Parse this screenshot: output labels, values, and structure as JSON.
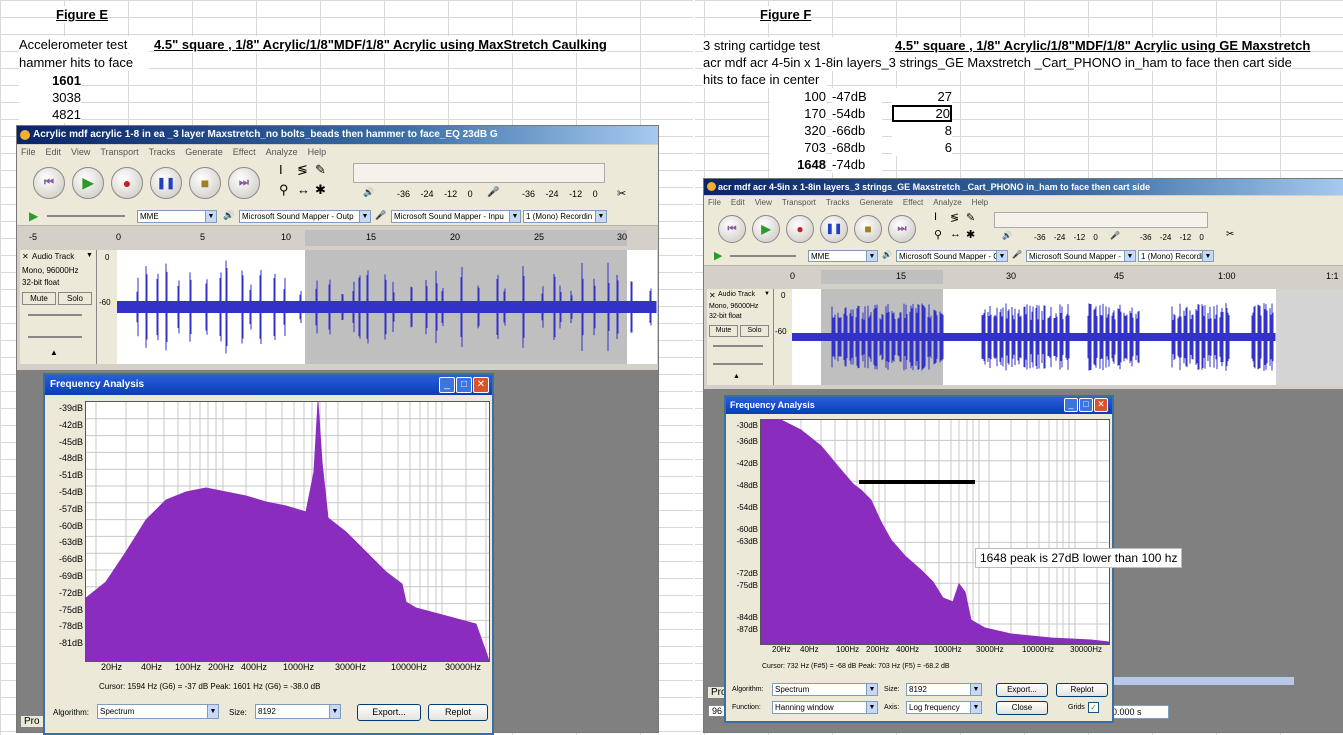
{
  "left": {
    "figure_title": "Figure E",
    "test_label": "Accelerometer test",
    "test_desc": "4.5\" square , 1/8\" Acrylic/1/8\"MDF/1/8\" Acrylic  using MaxStretch Caulking",
    "hits_label": "hammer hits to face",
    "values": [
      "1601",
      "3038",
      "4821"
    ],
    "window": {
      "title": "Acrylic mdf acrylic 1-8 in ea _3 layer Maxstretch_no bolts_beads then hammer to face_EQ 23dB G",
      "menu": [
        "File",
        "Edit",
        "View",
        "Transport",
        "Tracks",
        "Generate",
        "Effect",
        "Analyze",
        "Help"
      ],
      "meter_ticks": [
        "-36",
        "-24",
        "-12",
        "0",
        "-36",
        "-24",
        "-12",
        "0"
      ],
      "host": "MME",
      "output_device": "Microsoft Sound Mapper - Outp",
      "input_device": "Microsoft Sound Mapper - Inpu",
      "channels": "1 (Mono) Recordin",
      "ruler_ticks": [
        "-5",
        "0",
        "5",
        "10",
        "15",
        "20",
        "25",
        "30"
      ],
      "track_name": "Audio Track",
      "track_info1": "Mono, 96000Hz",
      "track_info2": "32-bit float",
      "mute": "Mute",
      "solo": "Solo",
      "db_top": "0",
      "db_mid": "-60",
      "pro": "Pro"
    },
    "analysis": {
      "title": "Frequency Analysis",
      "y_labels": [
        "-39dB",
        "-42dB",
        "-45dB",
        "-48dB",
        "-51dB",
        "-54dB",
        "-57dB",
        "-60dB",
        "-63dB",
        "-66dB",
        "-69dB",
        "-72dB",
        "-75dB",
        "-78dB",
        "-81dB"
      ],
      "x_labels": [
        "20Hz",
        "40Hz",
        "100Hz",
        "200Hz",
        "400Hz",
        "1000Hz",
        "3000Hz",
        "10000Hz",
        "30000Hz"
      ],
      "cursor_text": "Cursor: 1594 Hz (G6) = -37 dB   Peak: 1601 Hz (G6) = -38.0 dB",
      "algorithm_label": "Algorithm:",
      "algorithm": "Spectrum",
      "size_label": "Size:",
      "size": "8192",
      "export": "Export...",
      "replot": "Replot"
    }
  },
  "right": {
    "figure_title": "Figure F",
    "test_label": "3 string cartidge test",
    "test_desc": "4.5\" square , 1/8\" Acrylic/1/8\"MDF/1/8\" Acrylic  using GE Maxstretch",
    "desc_line": "acr mdf acr 4-5in x 1-8in layers_3 strings_GE Maxstretch _Cart_PHONO in_ham to face  then cart side",
    "hits_label": "hits to face in center",
    "rows": [
      {
        "freq": "100",
        "db": "-47dB",
        "val": "27"
      },
      {
        "freq": "170",
        "db": "-54db",
        "val": "20"
      },
      {
        "freq": "320",
        "db": "-66db",
        "val": "8"
      },
      {
        "freq": "703",
        "db": "-68db",
        "val": "6"
      },
      {
        "freq": "1648",
        "db": "-74db",
        "val": ""
      }
    ],
    "window": {
      "title": "acr mdf acr 4-5in x 1-8in layers_3 strings_GE Maxstretch _Cart_PHONO in_ham to face  then cart side",
      "menu": [
        "File",
        "Edit",
        "View",
        "Transport",
        "Tracks",
        "Generate",
        "Effect",
        "Analyze",
        "Help"
      ],
      "meter_ticks": [
        "-36",
        "-24",
        "-12",
        "0",
        "-36",
        "-24",
        "-12",
        "0"
      ],
      "host": "MME",
      "output_device": "Microsoft Sound Mapper - Outp",
      "input_device": "Microsoft Sound Mapper - Inpu",
      "channels": "1 (Mono) Recordin",
      "ruler_ticks": [
        "0",
        "15",
        "30",
        "45",
        "1:00",
        "1:1"
      ],
      "track_name": "Audio Track",
      "track_info1": "Mono, 96000Hz",
      "track_info2": "32-bit float",
      "mute": "Mute",
      "solo": "Solo",
      "db_top": "0",
      "db_mid": "-60",
      "pro": "Pro",
      "rate_partial": "96",
      "time_readout": "0.000 s"
    },
    "analysis": {
      "title": "Frequency Analysis",
      "y_labels": [
        "-30dB",
        "-36dB",
        "-42dB",
        "-48dB",
        "-54dB",
        "-60dB",
        "-63dB",
        "-72dB",
        "-75dB",
        "-84dB",
        "-87dB"
      ],
      "x_labels": [
        "20Hz",
        "40Hz",
        "100Hz",
        "200Hz",
        "400Hz",
        "1000Hz",
        "3000Hz",
        "10000Hz",
        "30000Hz"
      ],
      "cursor_text": "Cursor: 732 Hz (F#5) = -68 dB   Peak: 703 Hz (F5) = -68.2 dB",
      "annotation": "1648 peak is 27dB lower than 100 hz",
      "algorithm_label": "Algorithm:",
      "algorithm": "Spectrum",
      "size_label": "Size:",
      "size": "8192",
      "export": "Export...",
      "replot": "Replot",
      "function_label": "Function:",
      "function": "Hanning window",
      "axis_label": "Axis:",
      "axis": "Log frequency",
      "close": "Close",
      "grids": "Grids"
    }
  },
  "colors": {
    "waveform": "#3232c8",
    "spectrum": "#8a2cbe",
    "titlebar": "#0a246a",
    "selection": "#bfbfbf"
  }
}
